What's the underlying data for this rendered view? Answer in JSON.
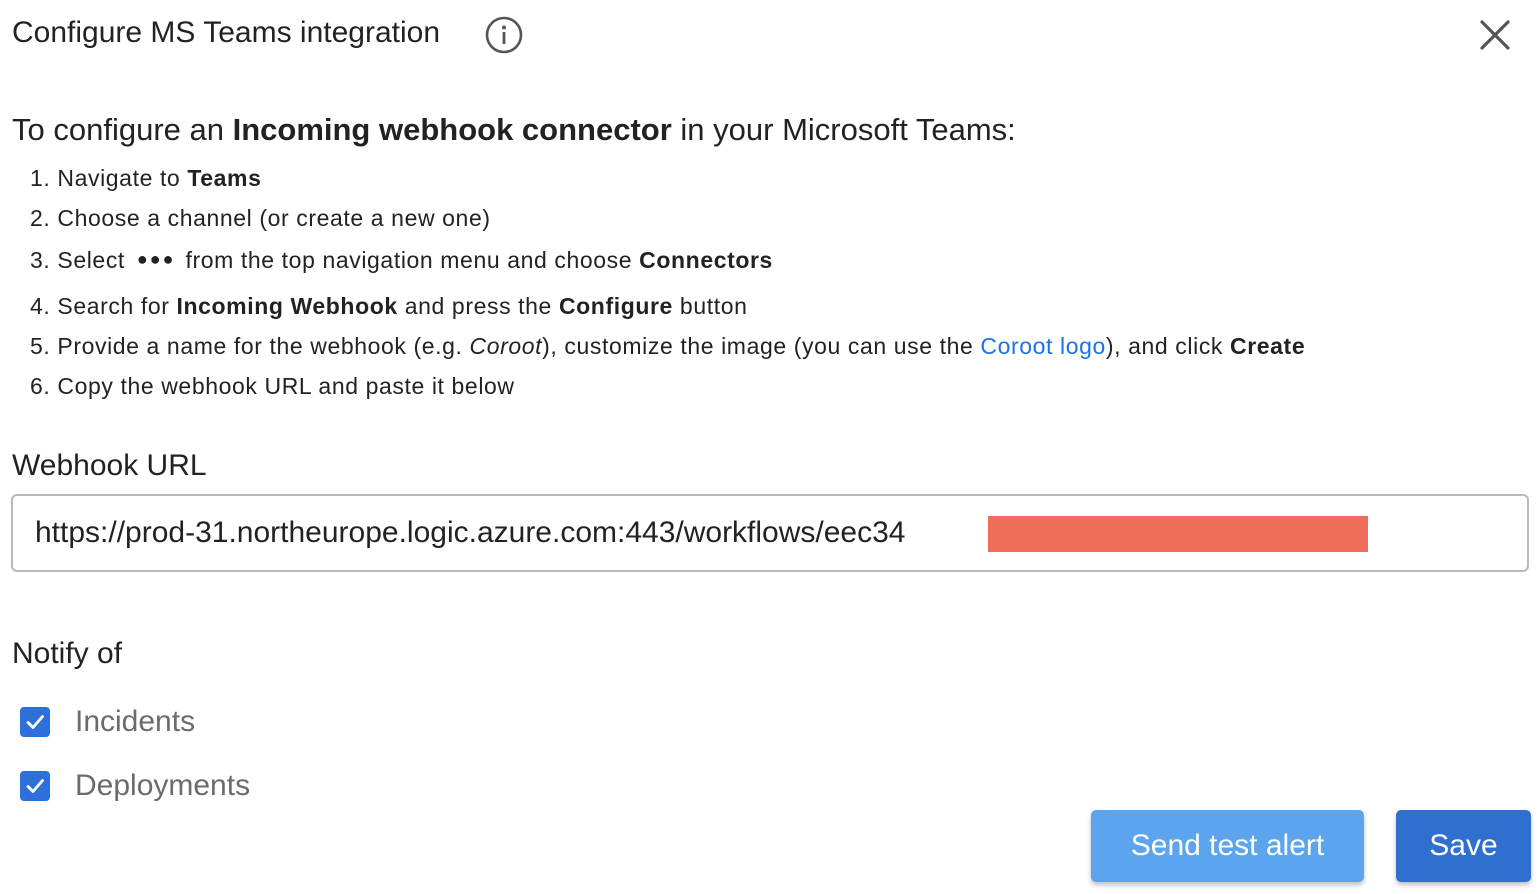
{
  "dialog": {
    "title": "Configure MS Teams integration",
    "info_icon": "info-circle-icon",
    "close_icon": "close-x-icon"
  },
  "instructions": {
    "intro_prefix": "To configure an ",
    "intro_bold": "Incoming webhook connector",
    "intro_suffix": " in your Microsoft Teams:",
    "steps": [
      {
        "num": "1.",
        "a": " Navigate to ",
        "b": "Teams"
      },
      {
        "num": "2.",
        "a": " Choose a channel (or create a new one)"
      },
      {
        "num": "3.",
        "a": " Select",
        "dots": "●●●",
        "c": "from the top navigation menu and choose ",
        "b": "Connectors"
      },
      {
        "num": "4.",
        "a": " Search for ",
        "b1": "Incoming Webhook",
        "c": " and press the ",
        "b2": "Configure",
        "d": " button"
      },
      {
        "num": "5.",
        "a": " Provide a name for the webhook (e.g. ",
        "i": "Coroot",
        "c": "), customize the image (you can use the ",
        "link": "Coroot logo",
        "d": "), and click ",
        "b": "Create"
      },
      {
        "num": "6.",
        "a": " Copy the webhook URL and paste it below"
      }
    ]
  },
  "webhook": {
    "label": "Webhook URL",
    "value": "https://prod-31.northeurope.logic.azure.com:443/workflows/eec34                              2e136b/tri"
  },
  "notify": {
    "label": "Notify of",
    "options": [
      {
        "label": "Incidents",
        "checked": true
      },
      {
        "label": "Deployments",
        "checked": true
      }
    ]
  },
  "buttons": {
    "test_label": "Send test alert",
    "save_label": "Save"
  },
  "colors": {
    "primary": "#2f6fcf",
    "primary_light": "#5da4ee",
    "link": "#1a73e8",
    "redaction": "#ee6e5b"
  }
}
